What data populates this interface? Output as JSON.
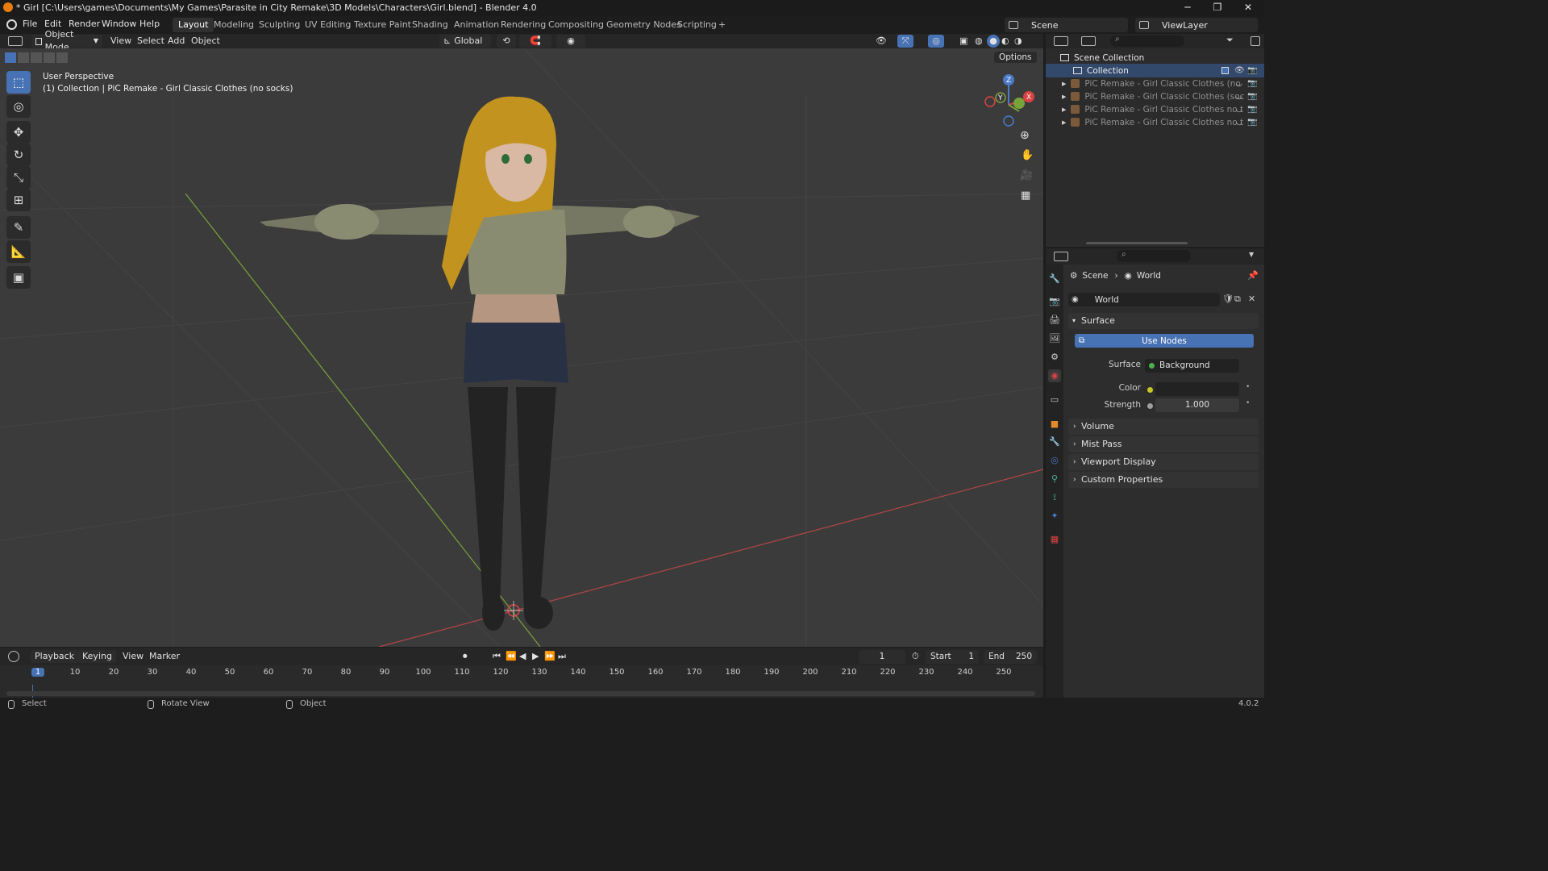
{
  "window": {
    "title": "* Girl [C:\\Users\\games\\Documents\\My Games\\Parasite in City Remake\\3D Models\\Characters\\Girl.blend] - Blender 4.0",
    "minimize": "─",
    "maximize": "❐",
    "close": "✕"
  },
  "menu": [
    "File",
    "Edit",
    "Render",
    "Window",
    "Help"
  ],
  "workspaces": [
    "Layout",
    "Modeling",
    "Sculpting",
    "UV Editing",
    "Texture Paint",
    "Shading",
    "Animation",
    "Rendering",
    "Compositing",
    "Geometry Nodes",
    "Scripting"
  ],
  "workspace_add": "+",
  "scene_selector": {
    "scene": "Scene",
    "view_layer": "ViewLayer"
  },
  "viewport_header": {
    "mode": "Object Mode",
    "menus": [
      "View",
      "Select",
      "Add",
      "Object"
    ],
    "transform_orientation": "Global",
    "options": "Options"
  },
  "viewport": {
    "perspective": "User Perspective",
    "object_info": "(1) Collection | PiC Remake - Girl Classic Clothes (no socks)",
    "gizmo": {
      "x": "X",
      "y": "Y",
      "z": "Z"
    },
    "colors": {
      "background": "#3b3b3b",
      "grid": "#444444",
      "x_axis": "#b64545",
      "y_axis": "#78a23a"
    }
  },
  "outliner": {
    "rows": [
      {
        "label": "Scene Collection"
      },
      {
        "label": "Collection"
      },
      {
        "label": "PiC Remake - Girl Classic Clothes (no"
      },
      {
        "label": "PiC Remake - Girl Classic Clothes (soc"
      },
      {
        "label": "PiC Remake - Girl Classic Clothes no t"
      },
      {
        "label": "PiC Remake - Girl Classic Clothes no t"
      }
    ]
  },
  "properties": {
    "breadcrumb": {
      "scene": "Scene",
      "world": "World"
    },
    "world_name": "World",
    "surface_panel": "Surface",
    "use_nodes": "Use Nodes",
    "surface_label": "Surface",
    "surface_value": "Background",
    "color_label": "Color",
    "strength_label": "Strength",
    "strength_value": "1.000",
    "collapsed_panels": [
      "Volume",
      "Mist Pass",
      "Viewport Display",
      "Custom Properties"
    ]
  },
  "timeline": {
    "menus": [
      "Playback",
      "Keying",
      "View",
      "Marker"
    ],
    "current_frame": "1",
    "start_label": "Start",
    "start": "1",
    "end_label": "End",
    "end": "250",
    "ticks": [
      "1",
      "10",
      "20",
      "30",
      "40",
      "50",
      "60",
      "70",
      "80",
      "90",
      "100",
      "110",
      "120",
      "130",
      "140",
      "150",
      "160",
      "170",
      "180",
      "190",
      "200",
      "210",
      "220",
      "230",
      "240",
      "250"
    ]
  },
  "statusbar": {
    "select": "Select",
    "rotate": "Rotate View",
    "object": "Object",
    "version": "4.0.2"
  }
}
